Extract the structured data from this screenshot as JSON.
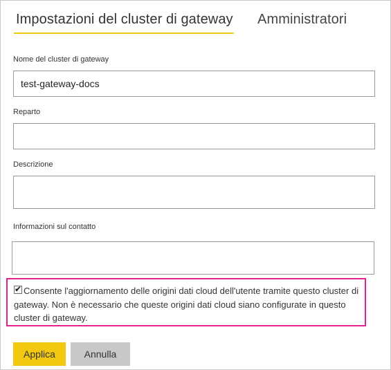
{
  "tabs": [
    {
      "label": "Impostazioni del cluster di gateway",
      "active": true
    },
    {
      "label": "Amministratori",
      "active": false
    }
  ],
  "fields": {
    "name": {
      "label": "Nome del cluster di gateway",
      "value": "test-gateway-docs"
    },
    "department": {
      "label": "Reparto",
      "value": ""
    },
    "description": {
      "label": "Descrizione",
      "value": ""
    },
    "contact": {
      "label": "Informazioni sul contatto",
      "value": ""
    }
  },
  "cloud_refresh": {
    "checked": true,
    "text": "Consente l'aggiornamento delle origini dati cloud dell'utente tramite questo cluster di gateway. Non è necessario che queste origini dati cloud siano configurate in questo cluster di gateway."
  },
  "buttons": {
    "apply": "Applica",
    "cancel": "Annulla"
  },
  "colors": {
    "accent": "#f2c811",
    "highlight": "#e3208c",
    "secondary_button": "#c8c8c8"
  }
}
